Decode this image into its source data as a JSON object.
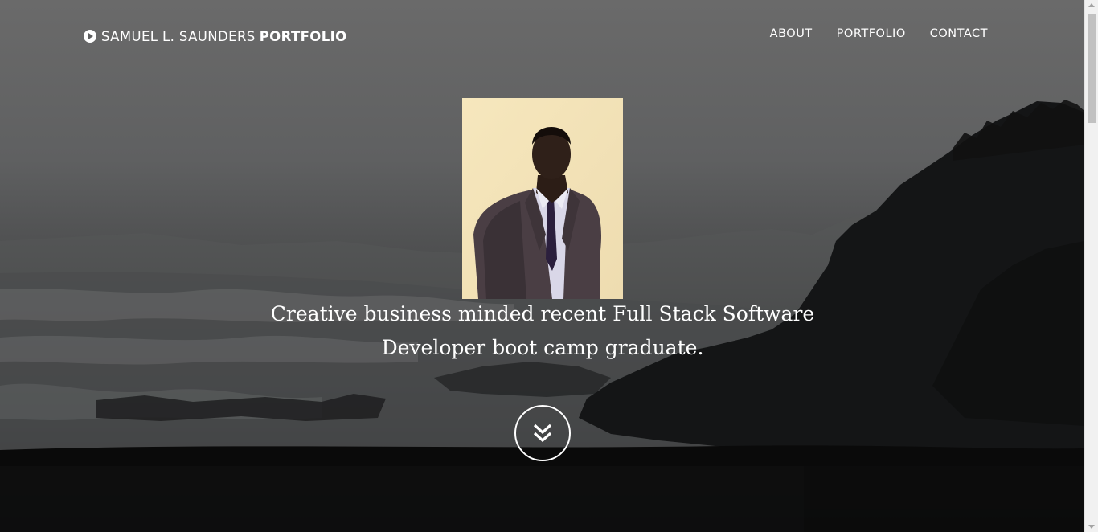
{
  "navbar": {
    "brand_name": "SAMUEL L. SAUNDERS",
    "brand_strong": "PORTFOLIO",
    "brand_icon": "play-circle-icon",
    "links": [
      "ABOUT",
      "PORTFOLIO",
      "CONTACT"
    ]
  },
  "hero": {
    "tagline_line1": "Creative business minded recent Full Stack Software",
    "tagline_line2": "Developer boot camp graduate.",
    "scroll_icon": "double-chevron-down-icon",
    "profile_photo": "profile-photo"
  },
  "colors": {
    "text": "#ffffff",
    "overlay_dark": "#070707",
    "background_gray": "#5f6061"
  }
}
